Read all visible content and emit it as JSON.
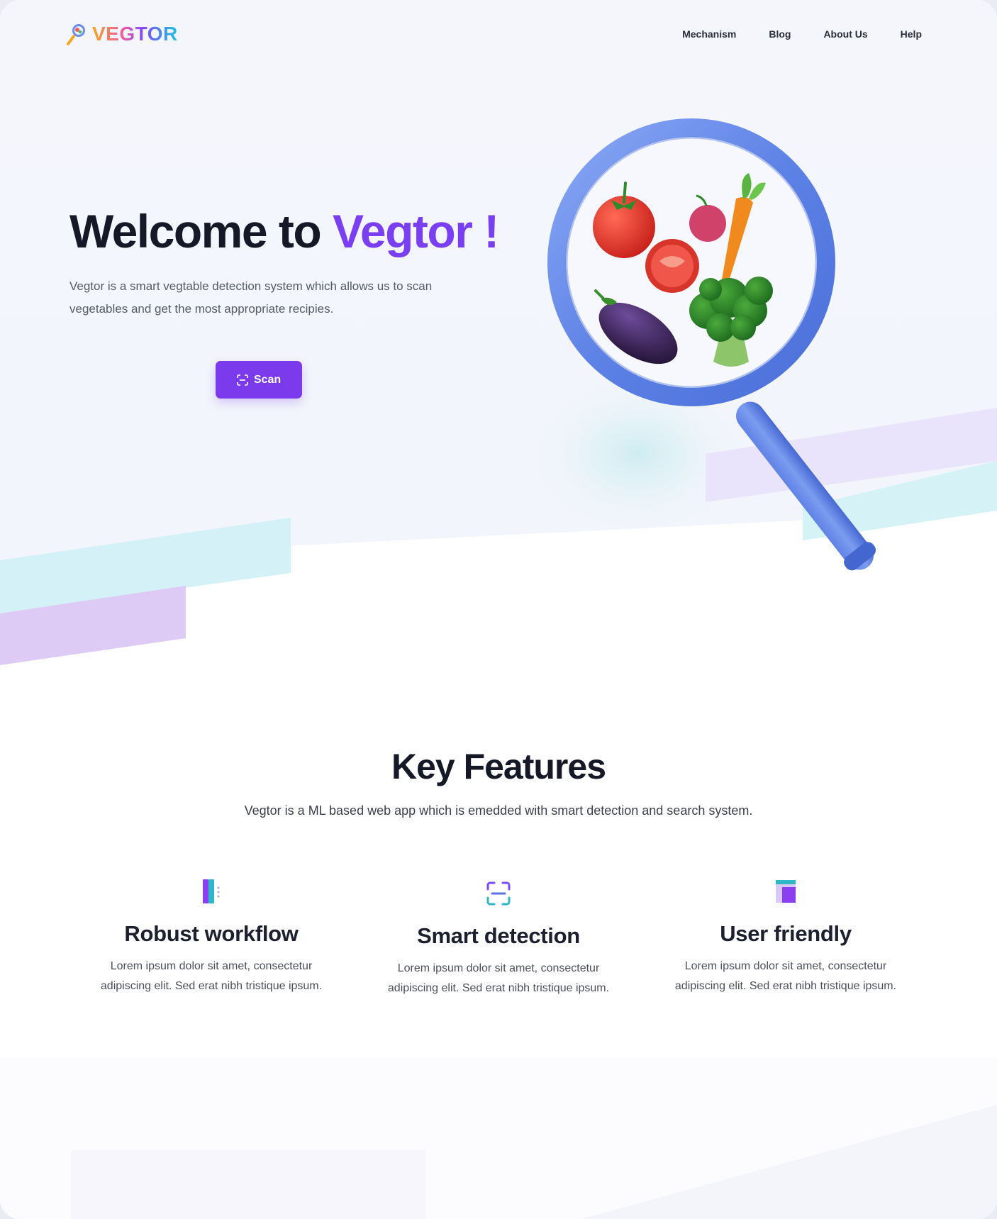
{
  "brand": {
    "name": "VEGTOR",
    "colors": {
      "orange": "#f5a623",
      "pink": "#f25c9c",
      "purple": "#7c4dff",
      "cyan": "#1ec6d8"
    }
  },
  "nav": {
    "items": [
      {
        "label": "Mechanism"
      },
      {
        "label": "Blog"
      },
      {
        "label": "About Us"
      },
      {
        "label": "Help"
      }
    ]
  },
  "hero": {
    "title_main": "Welcome to ",
    "title_accent": "Vegtor !",
    "description": "Vegtor is a smart vegtable detection system which allows us to scan vegetables and get the most appropriate recipies.",
    "scan_button": "Scan",
    "illustration": "magnifier-with-vegetables",
    "accent_color": "#7c3aed"
  },
  "features": {
    "title": "Key Features",
    "description": "Vegtor is a ML based web app which is emedded with smart detection and search system.",
    "items": [
      {
        "title": "Robust workflow",
        "text": "Lorem ipsum dolor sit amet, consectetur adipiscing elit. Sed erat nibh tristique ipsum.",
        "icon": "workflow-icon"
      },
      {
        "title": "Smart detection",
        "text": "Lorem ipsum dolor sit amet, consectetur adipiscing elit. Sed erat nibh tristique ipsum.",
        "icon": "scan-frame-icon"
      },
      {
        "title": "User friendly",
        "text": "Lorem ipsum dolor sit amet, consectetur adipiscing elit. Sed erat nibh tristique ipsum.",
        "icon": "layout-icon"
      }
    ]
  }
}
